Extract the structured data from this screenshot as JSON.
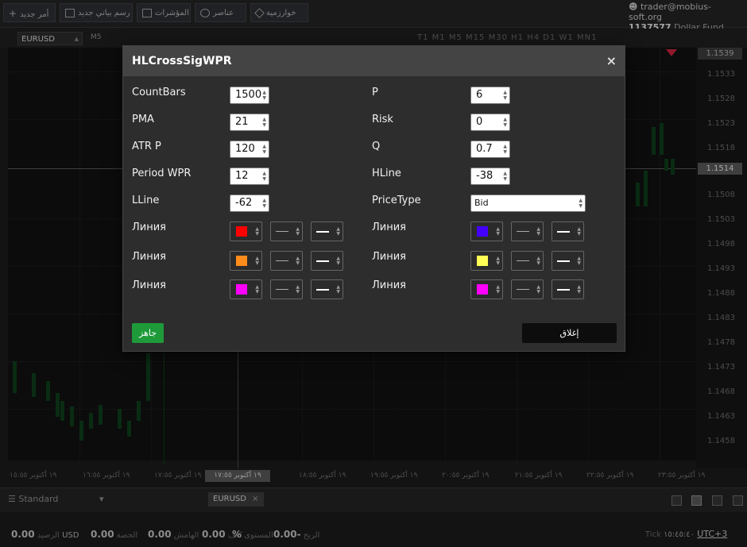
{
  "topbar": {
    "buttons": [
      {
        "label": "أمر جديد",
        "icon": "plus-icon"
      },
      {
        "label": "رسم بياني جديد",
        "icon": "chart-icon"
      },
      {
        "label": "المؤشرات",
        "icon": "indicators-icon"
      },
      {
        "label": "عناصر",
        "icon": "objects-icon"
      },
      {
        "label": "خوارزمية",
        "icon": "algo-icon"
      }
    ],
    "account_email": "trader@mobius-soft.org",
    "account_number": "1137577",
    "account_fund": "Dollar Fund"
  },
  "chart_toolbar": {
    "symbol": "EURUSD",
    "current_timeframe": "M5",
    "timeframes": [
      "T1",
      "M1",
      "M5",
      "M15",
      "M30",
      "H1",
      "H4",
      "D1",
      "W1",
      "MN1"
    ]
  },
  "price_axis": {
    "labels": [
      "1.1533",
      "1.1528",
      "1.1523",
      "1.1518",
      "1.1508",
      "1.1503",
      "1.1498",
      "1.1493",
      "1.1488",
      "1.1483",
      "1.1478",
      "1.1473",
      "1.1468",
      "1.1463",
      "1.1458"
    ],
    "top_box": "1.1539",
    "current_box": "1.1514"
  },
  "time_axis": {
    "labels": [
      "١٩ أكتوبر ١٥:٥٥",
      "١٩ أكتوبر ١٦:٥٥",
      "١٩ أكتوبر ١٧:٥٥",
      "١٩ أكتوبر ١٨:٥٥",
      "١٩ أكتوبر ١٩:٥٥",
      "١٩ أكتوبر ٢٠:٥٥",
      "١٩ أكتوبر ٢١:٥٥",
      "١٩ أكتوبر ٢٢:٥٥",
      "١٩ أكتوبر ٢٣:٥٥"
    ],
    "cursor_label": "١٩ أكتوبر ١٧:٥٥"
  },
  "bottom": {
    "layout_select": "Standard",
    "symbol_tab": "EURUSD",
    "status": {
      "balance_value": "0.00",
      "balance_currency": "USD",
      "balance_label": "الرصيد",
      "equity_value": "0.00",
      "equity_label": "الحصة",
      "margin_value": "0.00",
      "margin_label": "الهامش",
      "free_value": "0.00",
      "free_label": "كاف",
      "level_value": "%",
      "level_label": "المستوى",
      "profit_value": "0.00-",
      "profit_label": "الربح",
      "tick_label": "Tick",
      "tick_time": "١٥:٤٥:٤٠",
      "timezone": "UTC+3"
    }
  },
  "modal": {
    "title": "HLCrossSigWPR",
    "close_glyph": "×",
    "left_params": [
      {
        "label": "CountBars",
        "value": "1500"
      },
      {
        "label": "PMA",
        "value": "21"
      },
      {
        "label": "ATR P",
        "value": "120"
      },
      {
        "label": "Period WPR",
        "value": "12"
      },
      {
        "label": "LLine",
        "value": "-62"
      }
    ],
    "right_params": [
      {
        "label": "P",
        "value": "6"
      },
      {
        "label": "Risk",
        "value": "0"
      },
      {
        "label": "Q",
        "value": "0.7"
      },
      {
        "label": "HLine",
        "value": "-38"
      },
      {
        "label": "PriceType",
        "value": "Bid"
      }
    ],
    "left_lines": [
      {
        "label": "Линия",
        "color": "#ff0000"
      },
      {
        "label": "Линия",
        "color": "#ff8c1a"
      },
      {
        "label": "Линия",
        "color": "#ff00ff"
      }
    ],
    "right_lines": [
      {
        "label": "Линия",
        "color": "#4400ff"
      },
      {
        "label": "Линия",
        "color": "#ffff55"
      },
      {
        "label": "Линия",
        "color": "#ff00ff"
      }
    ],
    "ok_label": "جاهز",
    "cancel_label": "إغلاق"
  }
}
